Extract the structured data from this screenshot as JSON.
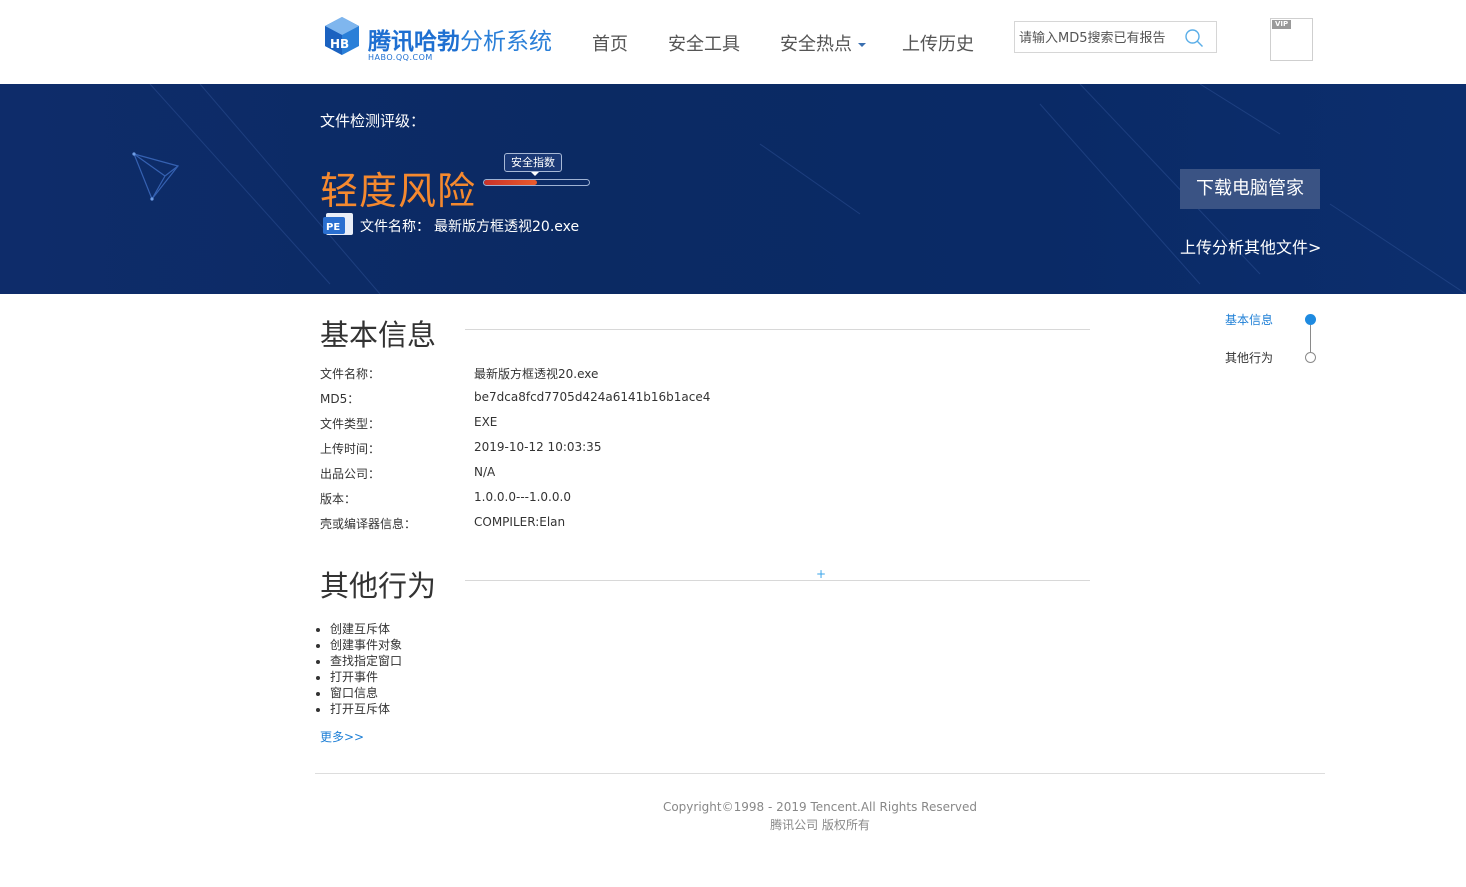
{
  "header": {
    "logo_title_bold": "腾讯哈勃",
    "logo_title_light": "分析系统",
    "logo_subtitle": "HABO.QQ.COM",
    "nav": [
      {
        "label": "首页"
      },
      {
        "label": "安全工具"
      },
      {
        "label": "安全热点"
      },
      {
        "label": "上传历史"
      }
    ],
    "search_placeholder": "请输入MD5搜索已有报告",
    "search_icon": "search-icon",
    "vip_badge": "VIP"
  },
  "banner": {
    "rating_label": "文件检测评级：",
    "risk_level": "轻度风险",
    "index_label": "安全指数",
    "index_level": 0.5,
    "file_type_icon_text": "PE",
    "file_name_label": "文件名称：",
    "file_name": "最新版方框透视20.exe",
    "download_button": "下载电脑管家",
    "upload_link": "上传分析其他文件>"
  },
  "basic_info": {
    "title": "基本信息",
    "rows": [
      {
        "key": "文件名称：",
        "value": "最新版方框透视20.exe"
      },
      {
        "key": "MD5：",
        "value": "be7dca8fcd7705d424a6141b16b1ace4"
      },
      {
        "key": "文件类型：",
        "value": "EXE"
      },
      {
        "key": "上传时间：",
        "value": "2019-10-12 10:03:35"
      },
      {
        "key": "出品公司：",
        "value": "N/A"
      },
      {
        "key": "版本：",
        "value": "1.0.0.0---1.0.0.0"
      },
      {
        "key": "壳或编译器信息：",
        "value": "COMPILER:Elan"
      }
    ]
  },
  "other_behavior": {
    "title": "其他行为",
    "plus": "+",
    "items": [
      "创建互斥体",
      "创建事件对象",
      "查找指定窗口",
      "打开事件",
      "窗口信息",
      "打开互斥体"
    ],
    "more_link": "更多>>"
  },
  "side_nav": {
    "items": [
      {
        "label": "基本信息",
        "active": true
      },
      {
        "label": "其他行为",
        "active": false
      }
    ]
  },
  "footer": {
    "copyright": "Copyright©1998 - 2019 Tencent.All Rights Reserved",
    "rights": "腾讯公司 版权所有"
  },
  "colors": {
    "brand_blue": "#1e6fd1",
    "banner_bg": "#0b2a63",
    "risk_orange": "#f5892f",
    "link_blue": "#1e7fd6"
  }
}
